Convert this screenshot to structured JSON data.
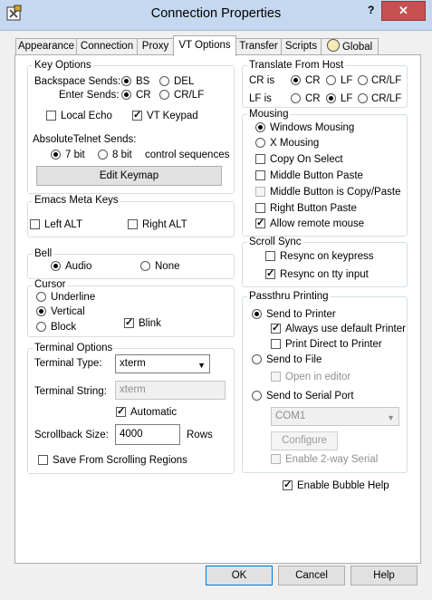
{
  "window": {
    "title": "Connection Properties",
    "help_glyph": "?",
    "close_glyph": "✕"
  },
  "tabs": [
    "Appearance",
    "Connection",
    "Proxy",
    "VT Options",
    "Transfer",
    "Scripts",
    "Global"
  ],
  "key_options": {
    "title": "Key Options",
    "backspace_label": "Backspace Sends:",
    "backspace_opts": [
      "BS",
      "DEL"
    ],
    "enter_label": "Enter Sends:",
    "enter_opts": [
      "CR",
      "CR/LF"
    ],
    "local_echo": "Local Echo",
    "vt_keypad": "VT Keypad",
    "telnet_label": "AbsoluteTelnet Sends:",
    "bit_opts": [
      "7 bit",
      "8 bit"
    ],
    "control_seq": "control sequences",
    "edit_keymap": "Edit Keymap"
  },
  "emacs": {
    "title": "Emacs Meta Keys",
    "left_alt": "Left ALT",
    "right_alt": "Right ALT"
  },
  "bell": {
    "title": "Bell",
    "audio": "Audio",
    "none": "None"
  },
  "cursor": {
    "title": "Cursor",
    "underline": "Underline",
    "vertical": "Vertical",
    "block": "Block",
    "blink": "Blink"
  },
  "terminal": {
    "title": "Terminal Options",
    "type_label": "Terminal Type:",
    "type_value": "xterm",
    "string_label": "Terminal String:",
    "string_value": "xterm",
    "automatic": "Automatic",
    "scrollback_label": "Scrollback Size:",
    "scrollback_value": "4000",
    "rows": "Rows",
    "save_scroll": "Save From Scrolling Regions"
  },
  "translate": {
    "title": "Translate From Host",
    "cr_label": "CR is",
    "lf_label": "LF is",
    "opts": [
      "CR",
      "LF",
      "CR/LF"
    ]
  },
  "mousing": {
    "title": "Mousing",
    "windows": "Windows Mousing",
    "x": "X Mousing",
    "copy_on_select": "Copy On Select",
    "middle_paste": "Middle Button Paste",
    "middle_copy_paste": "Middle Button is Copy/Paste",
    "right_paste": "Right Button Paste",
    "allow_remote": "Allow remote mouse"
  },
  "scroll_sync": {
    "title": "Scroll Sync",
    "resync_keypress": "Resync on keypress",
    "resync_tty": "Resync on tty input"
  },
  "passthru": {
    "title": "Passthru Printing",
    "send_printer": "Send to Printer",
    "default_printer": "Always use default Printer",
    "print_direct": "Print Direct to Printer",
    "send_file": "Send to File",
    "open_editor": "Open in editor",
    "send_serial": "Send to Serial Port",
    "com_value": "COM1",
    "configure": "Configure",
    "two_way": "Enable 2-way Serial"
  },
  "bubble_help": "Enable Bubble Help",
  "buttons": {
    "ok": "OK",
    "cancel": "Cancel",
    "help": "Help"
  },
  "check_glyph": "✓"
}
